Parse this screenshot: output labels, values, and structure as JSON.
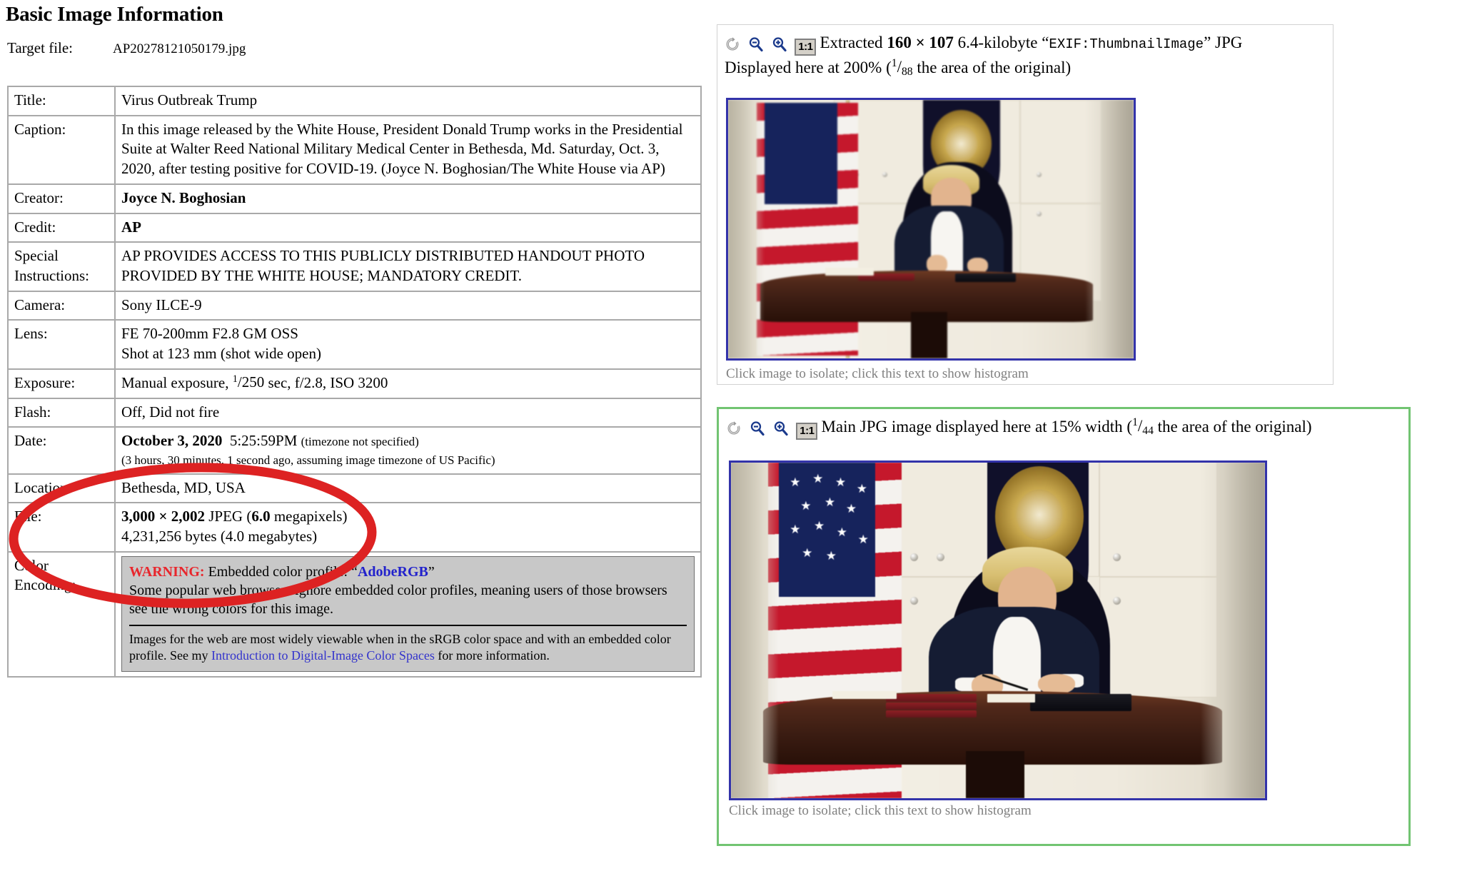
{
  "page": {
    "title": "Basic Image Information"
  },
  "target_file": {
    "label": "Target file:",
    "value": "AP20278121050179.jpg"
  },
  "info_table": {
    "rows": [
      {
        "label": "Title:",
        "value": "Virus Outbreak Trump"
      },
      {
        "label": "Caption:",
        "value": "In this image released by the White House, President Donald Trump works in the Presidential Suite at Walter Reed National Military Medical Center in Bethesda, Md. Saturday, Oct. 3, 2020, after testing positive for COVID-19. (Joyce N. Boghosian/The White House via AP)"
      },
      {
        "label": "Creator:",
        "value": "Joyce N. Boghosian"
      },
      {
        "label": "Credit:",
        "value": "AP"
      },
      {
        "label": "Special Instructions:",
        "value": "AP PROVIDES ACCESS TO THIS PUBLICLY DISTRIBUTED HANDOUT PHOTO PROVIDED BY THE WHITE HOUSE; MANDATORY CREDIT."
      },
      {
        "label": "Camera:",
        "value": "Sony ILCE-9"
      },
      {
        "label": "Lens:",
        "value_line1": "FE 70-200mm F2.8 GM OSS",
        "value_line2": "Shot at 123 mm (shot wide open)"
      },
      {
        "label": "Exposure:",
        "prefix": "Manual exposure, ",
        "frac_num": "1",
        "frac_den": "250",
        "suffix": " sec, f/2.8, ISO 3200"
      },
      {
        "label": "Flash:",
        "value": "Off, Did not fire"
      },
      {
        "label": "Date:",
        "date": "October 3, 2020",
        "time": "5:25:59PM",
        "tz_note": "(timezone not specified)",
        "ago_note": "(3 hours, 30 minutes, 1 second ago, assuming image timezone of US Pacific)"
      },
      {
        "label": "Location:",
        "value": "Bethesda, MD, USA"
      },
      {
        "label": "File:",
        "dims": "3,000 × 2,002",
        "format": " JPEG (",
        "mp": "6.0",
        "mp_suffix": " megapixels)",
        "bytes": "4,231,256 bytes (4.0 megabytes)"
      },
      {
        "label": "Color Encoding:",
        "warning_label": "WARNING:",
        "warning_text": " Embedded color profile: “",
        "profile": "AdobeRGB",
        "warning_text_end": "”",
        "body": "Some popular web browsers ignore embedded color profiles, meaning users of those browsers see the wrong colors for this image.",
        "sub_pre": "Images for the web are most widely viewable when in the sRGB color space and with an embedded color profile. See my ",
        "sub_link": "Introduction to Digital-Image Color Spaces",
        "sub_post": " for more information."
      }
    ]
  },
  "annotation": {
    "shape": "ellipse",
    "color": "#dd2222",
    "target": "Date row"
  },
  "thumb_panel": {
    "toolbar": {
      "reset_icon": "reset-rotate-icon",
      "zoom_out_icon": "zoom-out-icon",
      "zoom_in_icon": "zoom-in-icon",
      "one_to_one_label": "1:1"
    },
    "head_pre": "Extracted ",
    "head_dims": "160 × 107",
    "head_mid": " 6.4-kilobyte “",
    "head_mono": "EXIF:ThumbnailImage",
    "head_post": "” JPG",
    "head_line2_pre": "Displayed here at 200% (",
    "head_frac_num": "1",
    "head_frac_den": "88",
    "head_line2_post": " the area of the original)",
    "isolate_note": "Click image to isolate; click this text to show histogram"
  },
  "main_panel": {
    "toolbar": {
      "reset_icon": "reset-rotate-icon",
      "zoom_out_icon": "zoom-out-icon",
      "zoom_in_icon": "zoom-in-icon",
      "one_to_one_label": "1:1"
    },
    "head_pre": "Main JPG image displayed here at 15% width (",
    "head_frac_num": "1",
    "head_frac_den": "44",
    "head_post": " the area of the original)",
    "isolate_note": "Click image to isolate; click this text to show histogram"
  },
  "colors": {
    "panel_border_green": "#72c472",
    "image_border_blue": "#3333aa",
    "warning_red": "#e8262c",
    "link_blue": "#3333cc",
    "annotation_red": "#dd2222",
    "table_border_gray": "#a9a9a9"
  }
}
